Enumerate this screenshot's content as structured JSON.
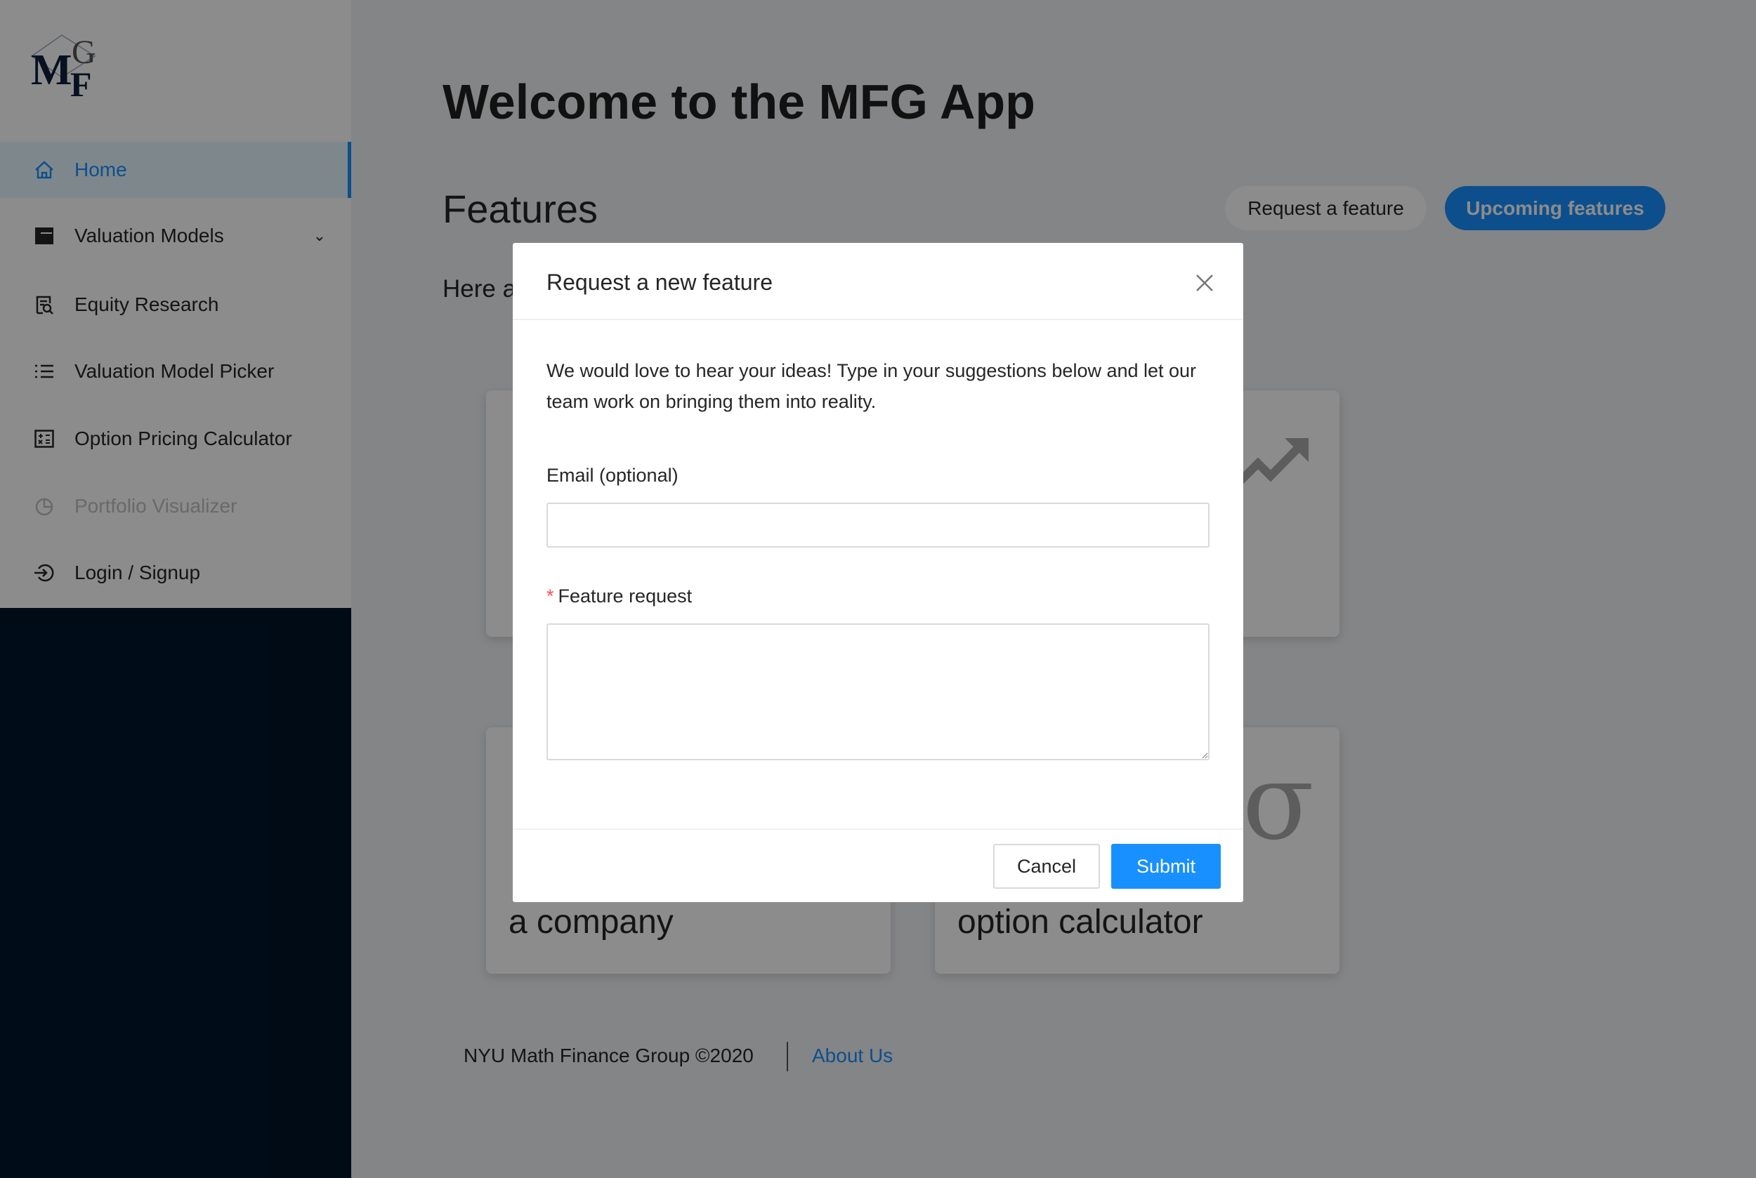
{
  "sidebar": {
    "logo": "MFG",
    "items": [
      {
        "label": "Home",
        "icon": "home-icon",
        "active": true
      },
      {
        "label": "Valuation Models",
        "icon": "layout-icon",
        "submenu": true
      },
      {
        "label": "Equity Research",
        "icon": "file-search-icon"
      },
      {
        "label": "Valuation Model Picker",
        "icon": "list-icon"
      },
      {
        "label": "Option Pricing Calculator",
        "icon": "calculator-icon"
      },
      {
        "label": "Portfolio Visualizer",
        "icon": "pie-chart-icon",
        "disabled": true
      },
      {
        "label": "Login / Signup",
        "icon": "login-icon"
      }
    ]
  },
  "main": {
    "title": "Welcome to the MFG App",
    "features_heading": "Features",
    "intro": "Here a",
    "request_button": "Request a feature",
    "upcoming_button": "Upcoming features",
    "cards": [
      {
        "text": "",
        "icon": ""
      },
      {
        "text": "",
        "icon": "trending-up-icon"
      },
      {
        "text": "a company",
        "icon": ""
      },
      {
        "text": "option calculator",
        "icon": "sigma-icon"
      }
    ],
    "sigma": "σ"
  },
  "footer": {
    "copyright": "NYU Math Finance Group ©2020",
    "about": "About Us"
  },
  "modal": {
    "title": "Request a new feature",
    "description": "We would love to hear your ideas! Type in your suggestions below and let our team work on bringing them into reality.",
    "email_label": "Email (optional)",
    "email_value": "",
    "feature_label": "Feature request",
    "required_mark": "*",
    "feature_value": "",
    "cancel": "Cancel",
    "submit": "Submit"
  },
  "colors": {
    "primary": "#1890ff",
    "sidebar_dark": "#001529",
    "required": "#ff4d4f"
  }
}
